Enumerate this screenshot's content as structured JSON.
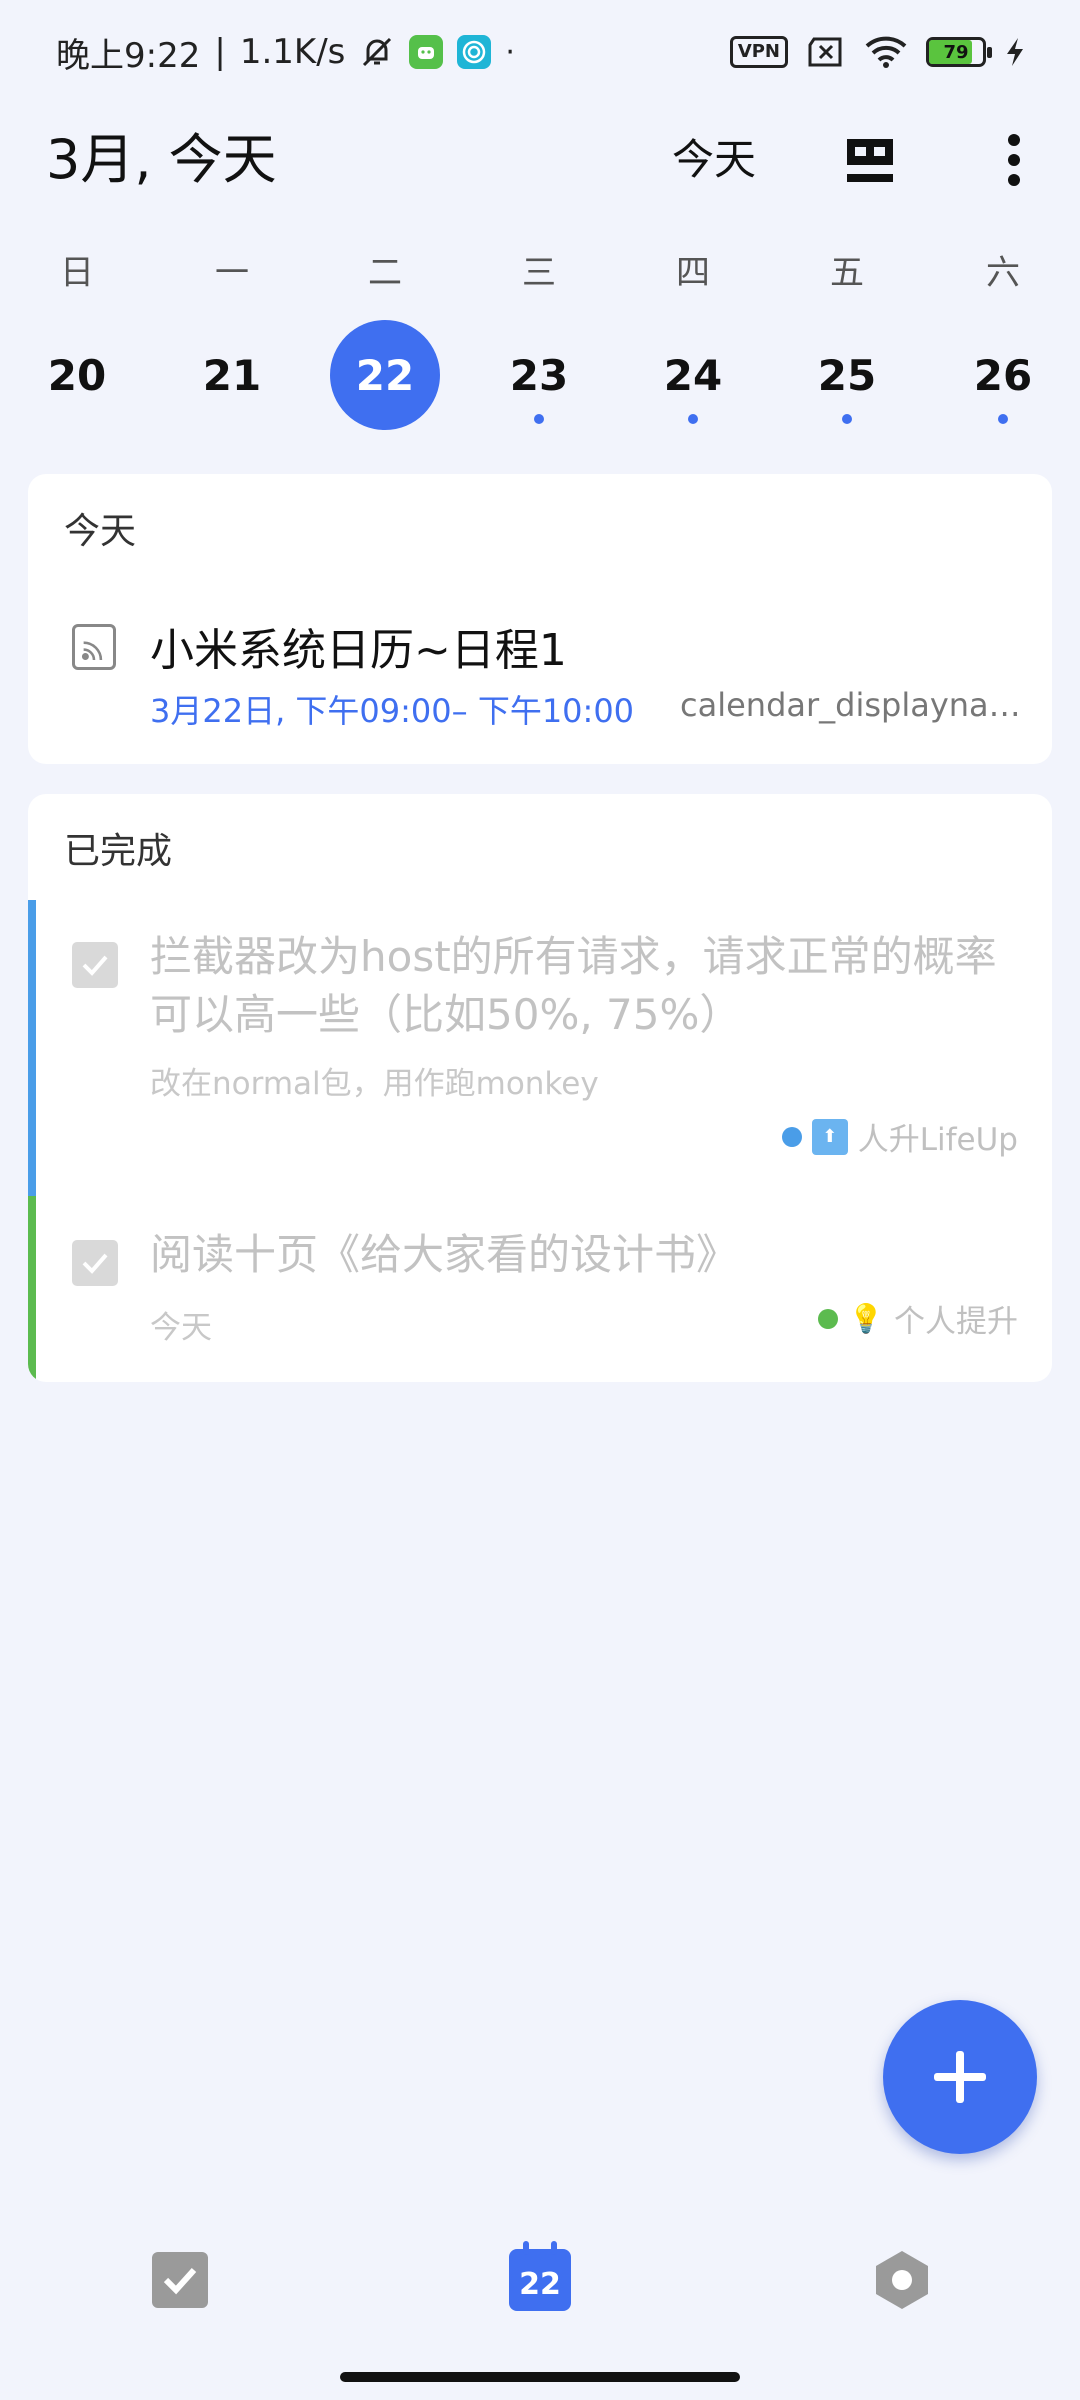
{
  "status_bar": {
    "time": "晚上9:22",
    "network_speed": "1.1K/s",
    "separator": "|",
    "dot": "·",
    "vpn": "VPN",
    "battery": "79",
    "icons": [
      "mute-bell-icon",
      "android-app-icon",
      "target-app-icon",
      "sim-x-icon",
      "wifi-icon",
      "charging-bolt-icon"
    ]
  },
  "header": {
    "title": "3月, 今天",
    "today_button": "今天",
    "view_toggle_icon": "calendar-view-icon",
    "more_icon": "more-vertical-icon"
  },
  "week": {
    "weekdays": [
      "日",
      "一",
      "二",
      "三",
      "四",
      "五",
      "六"
    ],
    "dates": [
      "20",
      "21",
      "22",
      "23",
      "24",
      "25",
      "26"
    ],
    "selected_index": 2,
    "dots": [
      false,
      false,
      false,
      true,
      true,
      true,
      true
    ]
  },
  "today_section": {
    "title": "今天",
    "event": {
      "icon": "calendar-feed-icon",
      "title": "小米系统日历~日程1",
      "time": "3月22日, 下午09:00– 下午10:00",
      "calendar": "calendar_displayna…"
    }
  },
  "completed_section": {
    "title": "已完成",
    "tasks": [
      {
        "title": "拦截器改为host的所有请求，请求正常的概率可以高一些（比如50%, 75%）",
        "note": "改在normal包，用作跑monkey",
        "tag_emoji": "⬆",
        "tag": "人升LifeUp",
        "bar_color": "#4a9de8",
        "dot_color": "#4a9de8"
      },
      {
        "title": "阅读十页《给大家看的设计书》",
        "note": "今天",
        "tag_emoji": "💡",
        "tag": "个人提升",
        "bar_color": "#5cbb4f",
        "dot_color": "#5cbb4f"
      }
    ]
  },
  "fab": {
    "icon": "plus-icon"
  },
  "bottom_nav": {
    "tasks_icon": "checkbox-icon",
    "calendar_day": "22",
    "settings_icon": "hexagon-settings-icon"
  },
  "colors": {
    "accent": "#3f6ff0",
    "background": "#f2f4fc"
  }
}
